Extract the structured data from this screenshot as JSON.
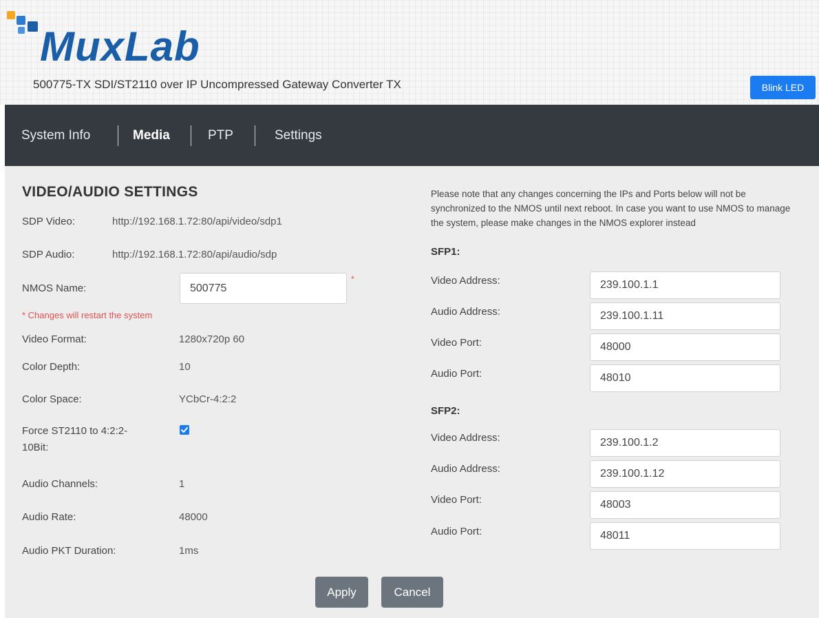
{
  "header": {
    "logo_text": "MuxLab",
    "product_title": "500775-TX SDI/ST2110 over IP Uncompressed Gateway Converter TX",
    "blink_led_label": "Blink LED"
  },
  "nav": {
    "items": [
      {
        "label": "System Info",
        "active": false
      },
      {
        "label": "Media",
        "active": true
      },
      {
        "label": "PTP",
        "active": false
      },
      {
        "label": "Settings",
        "active": false
      }
    ]
  },
  "settings": {
    "title": "VIDEO/AUDIO SETTINGS",
    "sdp_video_label": "SDP Video:",
    "sdp_video_value": "http://192.168.1.72:80/api/video/sdp1",
    "sdp_audio_label": "SDP Audio:",
    "sdp_audio_value": "http://192.168.1.72:80/api/audio/sdp",
    "nmos_name_label": "NMOS Name:",
    "nmos_name_value": "500775",
    "required_mark": "*",
    "restart_note": "* Changes will restart the system",
    "video_format_label": "Video Format:",
    "video_format_value": "1280x720p 60",
    "color_depth_label": "Color Depth:",
    "color_depth_value": "10",
    "color_space_label": "Color Space:",
    "color_space_value": "YCbCr-4:2:2",
    "force_label_line1": "Force ST2110 to 4:2:2-",
    "force_label_line2": "10Bit:",
    "force_checked": true,
    "audio_channels_label": "Audio Channels:",
    "audio_channels_value": "1",
    "audio_rate_label": "Audio Rate:",
    "audio_rate_value": "48000",
    "audio_pkt_label": "Audio PKT Duration:",
    "audio_pkt_value": "1ms"
  },
  "network": {
    "notice": "Please note that any changes concerning the IPs and Ports below will not be synchronized to the NMOS until next reboot. In case you want to use NMOS to manage the system, please make changes in the NMOS explorer instead",
    "sfp1": {
      "heading": "SFP1:",
      "video_address_label": "Video Address:",
      "video_address": "239.100.1.1",
      "audio_address_label": "Audio Address:",
      "audio_address": "239.100.1.11",
      "video_port_label": "Video Port:",
      "video_port": "48000",
      "audio_port_label": "Audio Port:",
      "audio_port": "48010"
    },
    "sfp2": {
      "heading": "SFP2:",
      "video_address_label": "Video Address:",
      "video_address": "239.100.1.2",
      "audio_address_label": "Audio Address:",
      "audio_address": "239.100.1.12",
      "video_port_label": "Video Port:",
      "video_port": "48003",
      "audio_port_label": "Audio Port:",
      "audio_port": "48011"
    }
  },
  "actions": {
    "apply_label": "Apply",
    "cancel_label": "Cancel"
  },
  "colors": {
    "navbar": "#343a40",
    "accent_blue": "#1a7cf0",
    "logo_blue": "#1a5ea8",
    "logo_orange": "#f5a623",
    "required_red": "#e05050",
    "button_gray": "#6c757d",
    "content_bg": "#ededed"
  },
  "icons": {
    "logo": "muxlab-logo-icon",
    "checkbox": "checkbox-checked-icon"
  }
}
